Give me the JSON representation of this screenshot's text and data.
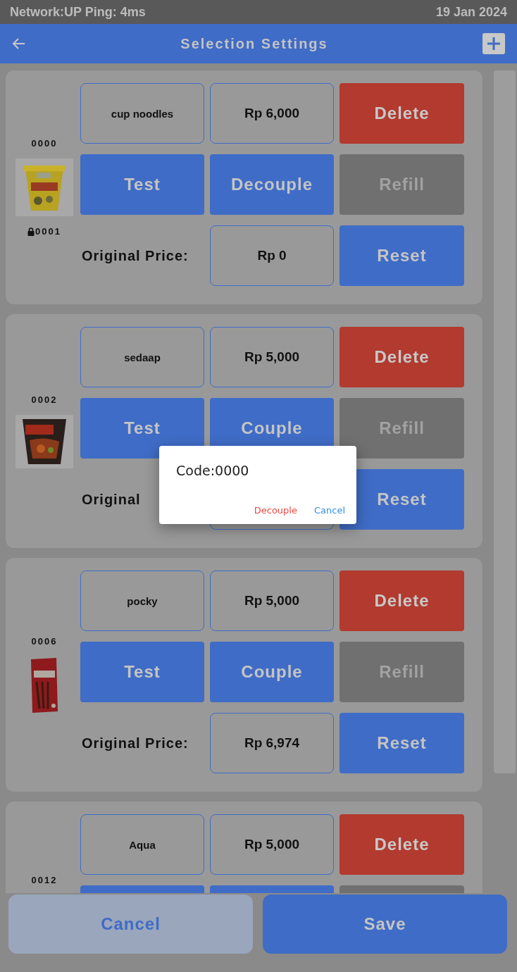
{
  "status_bar": {
    "network": "Network:UP Ping: 4ms",
    "date": "19 Jan 2024"
  },
  "header": {
    "title": "Selection Settings"
  },
  "products": [
    {
      "code": "0000",
      "locked_code": "0001",
      "name": "cup noodles",
      "price": "Rp 6,000",
      "buttons": [
        {
          "kind": "delete",
          "label": "Delete"
        },
        {
          "kind": "test",
          "label": "Test"
        },
        {
          "kind": "couple",
          "label": "Decouple"
        },
        {
          "kind": "refill",
          "label": "Refill"
        }
      ],
      "original_price_label": "Original Price:",
      "original_price": "Rp 0",
      "reset": "Reset"
    },
    {
      "code": "0002",
      "name": "sedaap",
      "price": "Rp 5,000",
      "buttons": [
        {
          "kind": "delete",
          "label": "Delete"
        },
        {
          "kind": "test",
          "label": "Test"
        },
        {
          "kind": "couple",
          "label": "Couple"
        },
        {
          "kind": "refill",
          "label": "Refill"
        }
      ],
      "original_price_label": "Original",
      "reset": "Reset"
    },
    {
      "code": "0006",
      "name": "pocky",
      "price": "Rp 5,000",
      "buttons": [
        {
          "kind": "delete",
          "label": "Delete"
        },
        {
          "kind": "test",
          "label": "Test"
        },
        {
          "kind": "couple",
          "label": "Couple"
        },
        {
          "kind": "refill",
          "label": "Refill"
        }
      ],
      "original_price_label": "Original Price:",
      "original_price": "Rp 6,974",
      "reset": "Reset"
    },
    {
      "code": "0012",
      "name": "Aqua",
      "price": "Rp 5,000",
      "buttons": [
        {
          "kind": "delete",
          "label": "Delete"
        },
        {
          "kind": "test"
        },
        {
          "kind": "couple"
        },
        {
          "kind": "refill"
        }
      ]
    }
  ],
  "dialog": {
    "message": "Code:0000",
    "buttons": [
      {
        "kind": "danger",
        "label": "Decouple"
      },
      {
        "kind": "normal",
        "label": "Cancel"
      }
    ]
  },
  "footer": {
    "cancel": "Cancel",
    "save": "Save"
  }
}
